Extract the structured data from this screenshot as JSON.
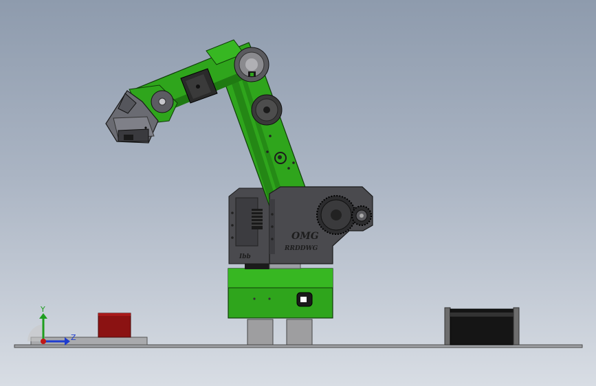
{
  "scene": {
    "engraving_brand": "OMG",
    "engraving_sub": "RRDDWG",
    "base_label": "Ibb",
    "colors": {
      "arm_green": "#2fa51c",
      "arm_green_dark": "#1f7a12",
      "housing_grey": "#4a4a4e",
      "block_red": "#8b1212",
      "motor_black": "#181818",
      "ground": "#a7a9ad"
    }
  },
  "triad": {
    "y_label": "Y",
    "z_label": "Z",
    "y_color": "#1e9e1e",
    "z_color": "#1e3ccf",
    "x_color": "#c01818"
  }
}
